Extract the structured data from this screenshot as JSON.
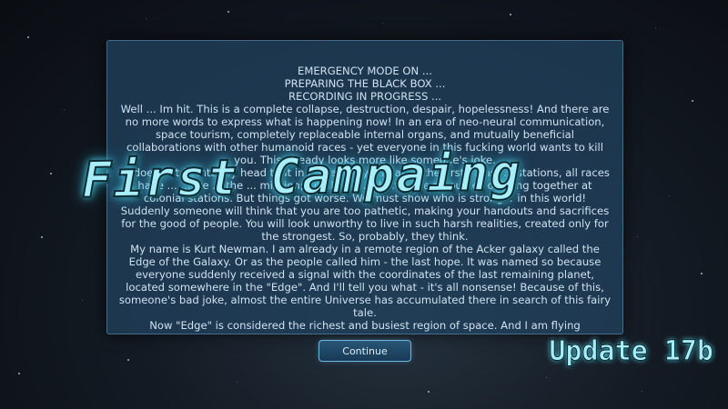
{
  "story": {
    "header_lines": [
      "EMERGENCY MODE ON ...",
      "PREPARING THE BLACK BOX ...",
      "RECORDING IN PROGRESS ..."
    ],
    "paragraphs": [
      "Well ... Im hit. This is a complete collapse, destruction, despair, hopelessness! And there are no more words to express what is happening now! In an era of neo-neural communication, space tourism, completely replaceable internal organs, and mutually beneficial collaborations with other humanoid races - yet everyone in this fucking world wants to kill you. This already looks more like someone's joke.",
      "... does not fit into my head that in just a few years after the first ... last ... stations, all races have ... ... we ... the ... mission; problems ... shared the resources of living together at colonial stations. But things got worse. We must show who is stronger in this world! Suddenly someone will think that you are too pathetic, making your handouts and sacrifices for the good of people. You will look unworthy to live in such harsh realities, created only for the strongest. So, probably, they think.",
      "My name is Kurt Newman. I am already in a remote region of the Acker galaxy called the Edge of the Galaxy. Or as the people called him - the last hope. It was named so because everyone suddenly received a signal with the coordinates of the last remaining planet, located somewhere in the \"Edge\". And I'll tell you what - it's all nonsense! Because of this, someone's bad joke, almost the entire Universe has accumulated there in search of this fairy tale.",
      "Now \"Edge\" is considered the richest and busiest region of space. And I am flying"
    ]
  },
  "continue_label": "Continue",
  "overlay_title": "First Campaing",
  "update_label": "Update 17b",
  "colors": {
    "panel": "#204060",
    "title_glow": "#5fd9ee",
    "button_border": "#6fb6e0"
  }
}
